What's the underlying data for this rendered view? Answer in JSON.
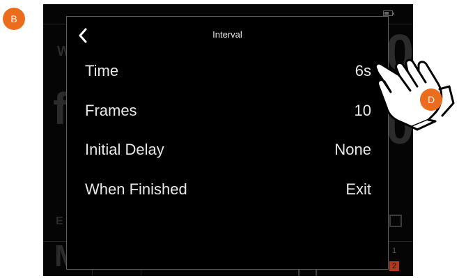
{
  "dialog": {
    "title": "Interval",
    "rows": [
      {
        "label": "Time",
        "value": "6s"
      },
      {
        "label": "Frames",
        "value": "10"
      },
      {
        "label": "Initial Delay",
        "value": "None"
      },
      {
        "label": "When Finished",
        "value": "Exit"
      }
    ]
  },
  "callouts": {
    "b": "B",
    "d": "D"
  },
  "icons": {
    "back": "chevron-left-icon",
    "pointer": "pointing-hand-icon",
    "battery": "battery-icon"
  },
  "colors": {
    "callout": "#ea6c1c",
    "screen_background": "#050505",
    "dialog_border": "#5f5f5f",
    "text": "#e8e8e8"
  }
}
